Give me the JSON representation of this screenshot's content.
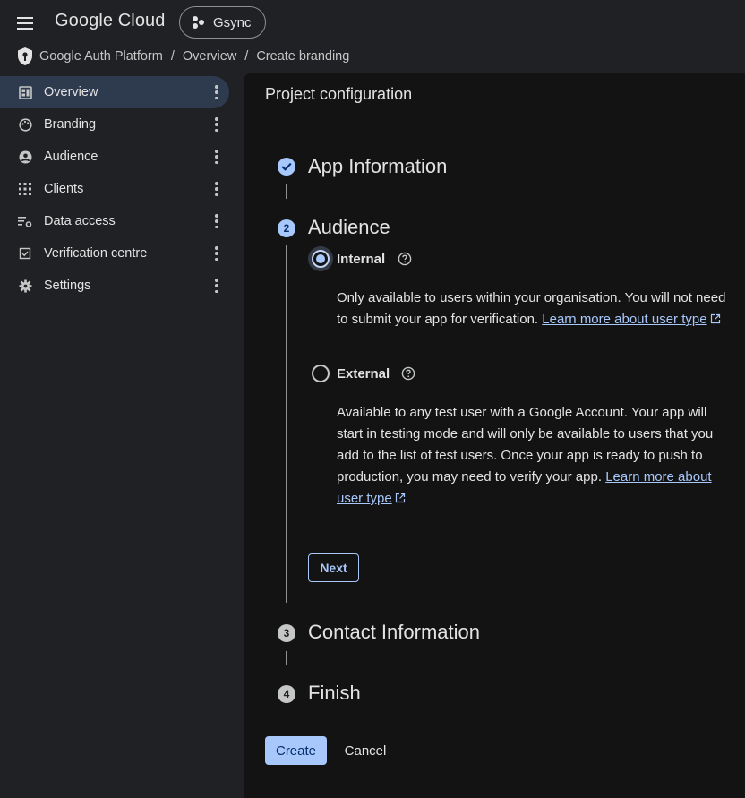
{
  "header": {
    "logo_text": "Google Cloud",
    "project_name": "Gsync"
  },
  "breadcrumb": [
    "Google Auth Platform",
    "Overview",
    "Create branding"
  ],
  "sidebar": {
    "items": [
      {
        "label": "Overview",
        "icon": "dashboard-icon",
        "active": true
      },
      {
        "label": "Branding",
        "icon": "palette-icon",
        "active": false
      },
      {
        "label": "Audience",
        "icon": "account-circle-icon",
        "active": false
      },
      {
        "label": "Clients",
        "icon": "apps-grid-icon",
        "active": false
      },
      {
        "label": "Data access",
        "icon": "data-settings-icon",
        "active": false
      },
      {
        "label": "Verification centre",
        "icon": "checkbox-icon",
        "active": false
      },
      {
        "label": "Settings",
        "icon": "gear-icon",
        "active": false
      }
    ]
  },
  "main": {
    "title": "Project configuration",
    "steps": [
      {
        "number": "1",
        "title": "App Information",
        "state": "done"
      },
      {
        "number": "2",
        "title": "Audience",
        "state": "current"
      },
      {
        "number": "3",
        "title": "Contact Information",
        "state": "upcoming"
      },
      {
        "number": "4",
        "title": "Finish",
        "state": "upcoming"
      }
    ],
    "audience": {
      "internal": {
        "label": "Internal",
        "selected": true,
        "description": "Only available to users within your organisation. You will not need to submit your app for verification.",
        "link": "Learn more about user type"
      },
      "external": {
        "label": "External",
        "selected": false,
        "description": "Available to any test user with a Google Account. Your app will start in testing mode and will only be available to users that you add to the list of test users. Once your app is ready to push to production, you may need to verify your app.",
        "link": "Learn more about user type"
      },
      "next_label": "Next"
    },
    "create_label": "Create",
    "cancel_label": "Cancel"
  },
  "colors": {
    "accent": "#a8c7fa",
    "background": "#202124",
    "panel": "#131314",
    "sidebar_active": "#2e3a4e"
  }
}
